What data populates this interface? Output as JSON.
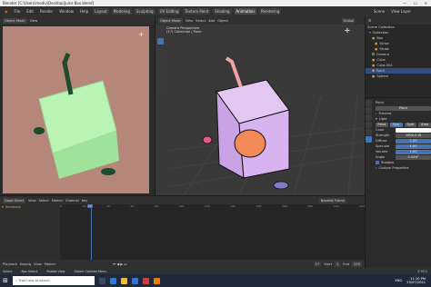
{
  "window": {
    "title": "Blender [C:\\Users\\mediv\\Desktop\\Juice Box.blend]",
    "minimize": "—",
    "maximize": "☐",
    "close": "✕"
  },
  "menu": {
    "items": [
      "File",
      "Edit",
      "Render",
      "Window",
      "Help"
    ],
    "workspaces": [
      "Layout",
      "Modeling",
      "Sculpting",
      "UV Editing",
      "Texture Paint",
      "Shading",
      "Animation",
      "Rendering",
      "Compositing",
      "Scripting"
    ],
    "active_workspace": "Animation",
    "scene_label": "Scene",
    "view_layer_label": "View Layer"
  },
  "left_viewport": {
    "mode": "Object Mode",
    "view": "View",
    "bg_color": "#b5877a"
  },
  "main_viewport": {
    "mode": "Object Mode",
    "view": "View",
    "select": "Select",
    "add": "Add",
    "object": "Object",
    "orientation": "Global",
    "info_line1": "Camera Perspective",
    "info_line2": "(17) Collection | Point"
  },
  "outliner": {
    "title": "Scene Collection",
    "items": [
      {
        "label": "Collection",
        "indent": 1
      },
      {
        "label": "Box",
        "indent": 2
      },
      {
        "label": "Straw",
        "indent": 3
      },
      {
        "label": "Straw",
        "indent": 3
      },
      {
        "label": "Camera",
        "indent": 2
      },
      {
        "label": "Cube",
        "indent": 2
      },
      {
        "label": "Cube.001",
        "indent": 2
      },
      {
        "label": "Point",
        "indent": 2
      },
      {
        "label": "Sphere",
        "indent": 2
      }
    ]
  },
  "properties": {
    "object_name": "Point",
    "light_name": "Point",
    "sections": {
      "preview": "Preview",
      "light": "Light"
    },
    "light_types": [
      "Point",
      "Sun",
      "Spot",
      "Area"
    ],
    "active_light_type": "Sun",
    "color_label": "Color",
    "strength_label": "Strength",
    "strength_value": "1000.0 W",
    "diffuse_label": "Diffuse",
    "diffuse_value": "1.00",
    "specular_label": "Specular",
    "specular_value": "1.00",
    "volume_label": "Volume",
    "volume_value": "1.00",
    "angle_label": "Angle",
    "angle_value": "0.526°",
    "shadow_label": "Shadow",
    "custom_props_label": "Custom Properties"
  },
  "dopesheet": {
    "mode": "Dope Sheet",
    "menus": [
      "View",
      "Select",
      "Marker",
      "Channel",
      "Key"
    ],
    "summary": "Summary",
    "keying": "Nearest Frame",
    "current_frame": "17",
    "ticks": [
      "0",
      "10",
      "17",
      "20",
      "30",
      "40",
      "50",
      "60",
      "70",
      "80",
      "90",
      "100",
      "110",
      "120",
      "130",
      "140",
      "150",
      "160",
      "170",
      "180",
      "190",
      "200",
      "210",
      "220",
      "230",
      "240",
      "250"
    ]
  },
  "playback": {
    "playback": "Playback",
    "keying": "Keying",
    "view": "View",
    "marker": "Marker",
    "frame": "17",
    "start_label": "Start",
    "start_value": "1",
    "end_label": "End",
    "end_value": "250"
  },
  "status": {
    "select": "Select",
    "box_select": "Box Select",
    "rotate": "Rotate View",
    "context": "Object Context Menu",
    "version": "2.93.1"
  },
  "taskbar": {
    "search_placeholder": "Type here to search",
    "time": "11:10 PM",
    "date": "25/07/2021",
    "lang": "ENG"
  }
}
